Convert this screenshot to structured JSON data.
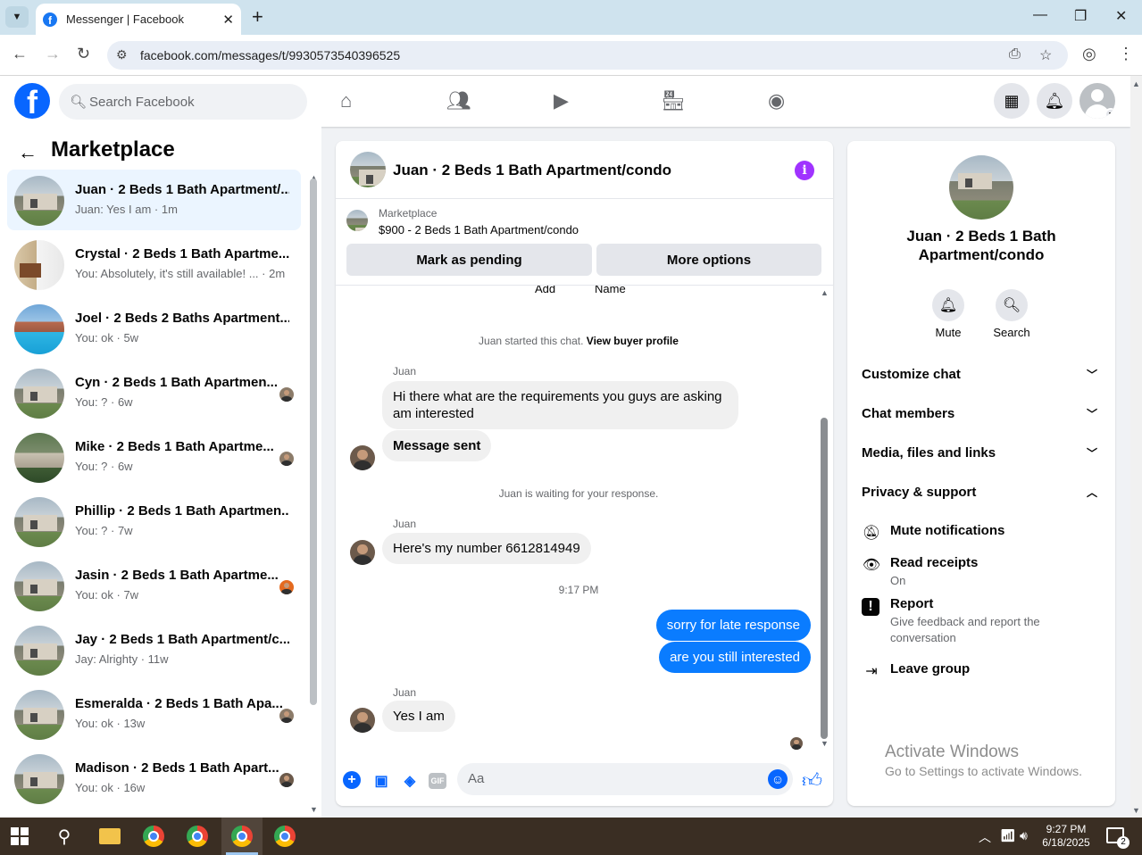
{
  "browser": {
    "tab_title": "Messenger | Facebook",
    "url": "facebook.com/messages/t/9930573540396525"
  },
  "header": {
    "search_placeholder": "Search Facebook"
  },
  "sidebar": {
    "title": "Marketplace",
    "conversations": [
      {
        "name": "Juan · 2 Beds 1 Bath Apartment/...",
        "preview": "Juan: Yes I am · 1m",
        "thumb": "house",
        "active": true
      },
      {
        "name": "Crystal · 2 Beds 1 Bath Apartme...",
        "preview": "You: Absolutely, it's still available! ... · 2m",
        "thumb": "kitchen"
      },
      {
        "name": "Joel · 2 Beds 2 Baths Apartment...",
        "preview": "You: ok · 5w",
        "thumb": "pool"
      },
      {
        "name": "Cyn · 2 Beds 1 Bath Apartmen...",
        "preview": "You: ? · 6w",
        "thumb": "house"
      },
      {
        "name": "Mike · 2 Beds 1 Bath Apartme...",
        "preview": "You: ? · 6w",
        "thumb": "garden"
      },
      {
        "name": "Phillip · 2 Beds 1 Bath Apartmen...",
        "preview": "You: ? · 7w",
        "thumb": "house"
      },
      {
        "name": "Jasin · 2 Beds 1 Bath Apartme...",
        "preview": "You: ok · 7w",
        "thumb": "house"
      },
      {
        "name": "Jay · 2 Beds 1 Bath Apartment/c...",
        "preview": "Jay: Alrighty · 11w",
        "thumb": "house"
      },
      {
        "name": "Esmeralda · 2 Beds 1 Bath Apa...",
        "preview": "You: ok · 13w",
        "thumb": "house"
      },
      {
        "name": "Madison · 2 Beds 1 Bath Apart...",
        "preview": "You: ok · 16w",
        "thumb": "house"
      }
    ]
  },
  "chat": {
    "title": "Juan · 2 Beds 1 Bath Apartment/condo",
    "marketplace_label": "Marketplace",
    "listing": "$900 - 2 Beds 1 Bath Apartment/condo",
    "mark_pending_label": "Mark as pending",
    "more_options_label": "More options",
    "cut_add": "Add",
    "cut_name": "Name",
    "started_text": "Juan started this chat.",
    "view_profile": "View buyer profile",
    "sender": "Juan",
    "msg1": "Hi there what are the requirements you guys are asking am interested",
    "msg2": "Message sent",
    "waiting_text": "Juan is waiting for your response.",
    "msg3": "Here's my number 6612814949",
    "time": "9:17 PM",
    "out1": "sorry for late response",
    "out2": "are you still interested",
    "msg4": "Yes I am",
    "composer_placeholder": "Aa",
    "gif_label": "GIF"
  },
  "details": {
    "name": "Juan · 2 Beds 1 Bath Apartment/condo",
    "mute_label": "Mute",
    "search_label": "Search",
    "sections": [
      "Customize chat",
      "Chat members",
      "Media, files and links",
      "Privacy & support"
    ],
    "mute_notifications": "Mute notifications",
    "read_receipts": "Read receipts",
    "read_receipts_state": "On",
    "report": "Report",
    "report_desc": "Give feedback and report the conversation",
    "leave_group": "Leave group"
  },
  "watermark": {
    "line1": "Activate Windows",
    "line2": "Go to Settings to activate Windows."
  },
  "taskbar": {
    "time": "9:27 PM",
    "date": "6/18/2025",
    "notif_count": "2"
  },
  "colors": {
    "brand": "#0866ff",
    "outgoing_bubble": "#0a7cff",
    "info_icon": "#a033ff"
  }
}
